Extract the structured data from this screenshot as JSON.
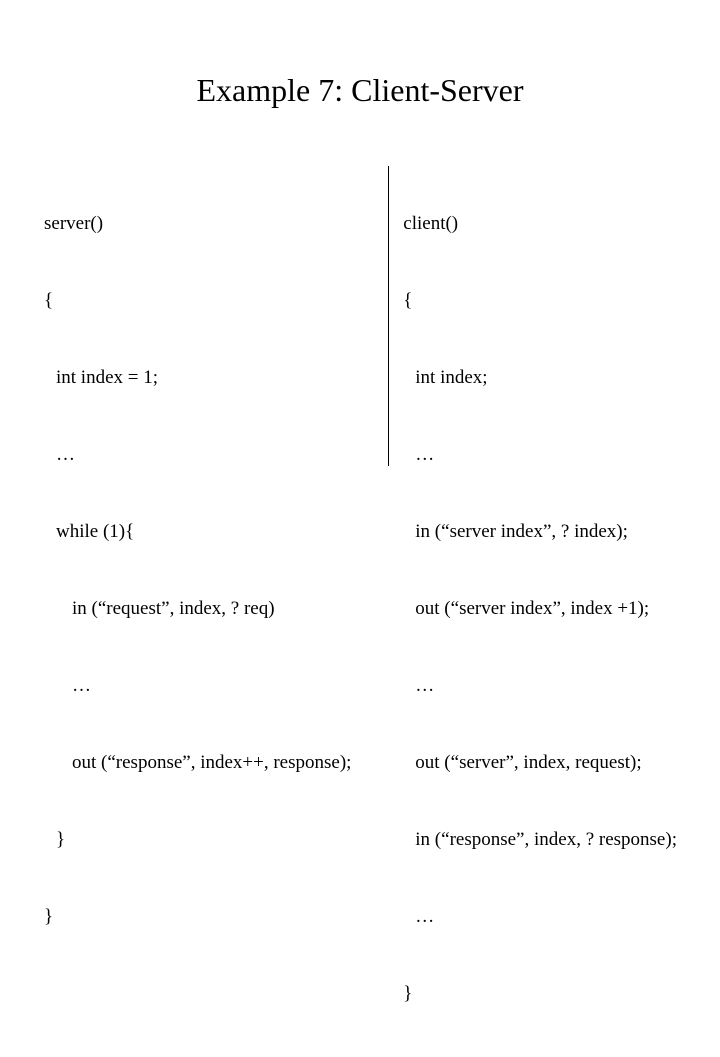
{
  "title": "Example 7: Client-Server",
  "server": {
    "l0": "server()",
    "l1": "{",
    "l2": "int index = 1;",
    "l3": "…",
    "l4": "while (1){",
    "l5": "in (“request”, index, ? req)",
    "l6": "…",
    "l7": "out (“response”, index++, response);",
    "l8": "}",
    "l9": "}"
  },
  "client": {
    "l0": "client()",
    "l1": "{",
    "l2": "int index;",
    "l3": "…",
    "l4": "in (“server index”, ? index);",
    "l5": "out (“server index”, index +1);",
    "l6": "…",
    "l7": "out (“server”, index, request);",
    "l8": "in (“response”, index, ? response);",
    "l9": "…",
    "l10": "}"
  }
}
